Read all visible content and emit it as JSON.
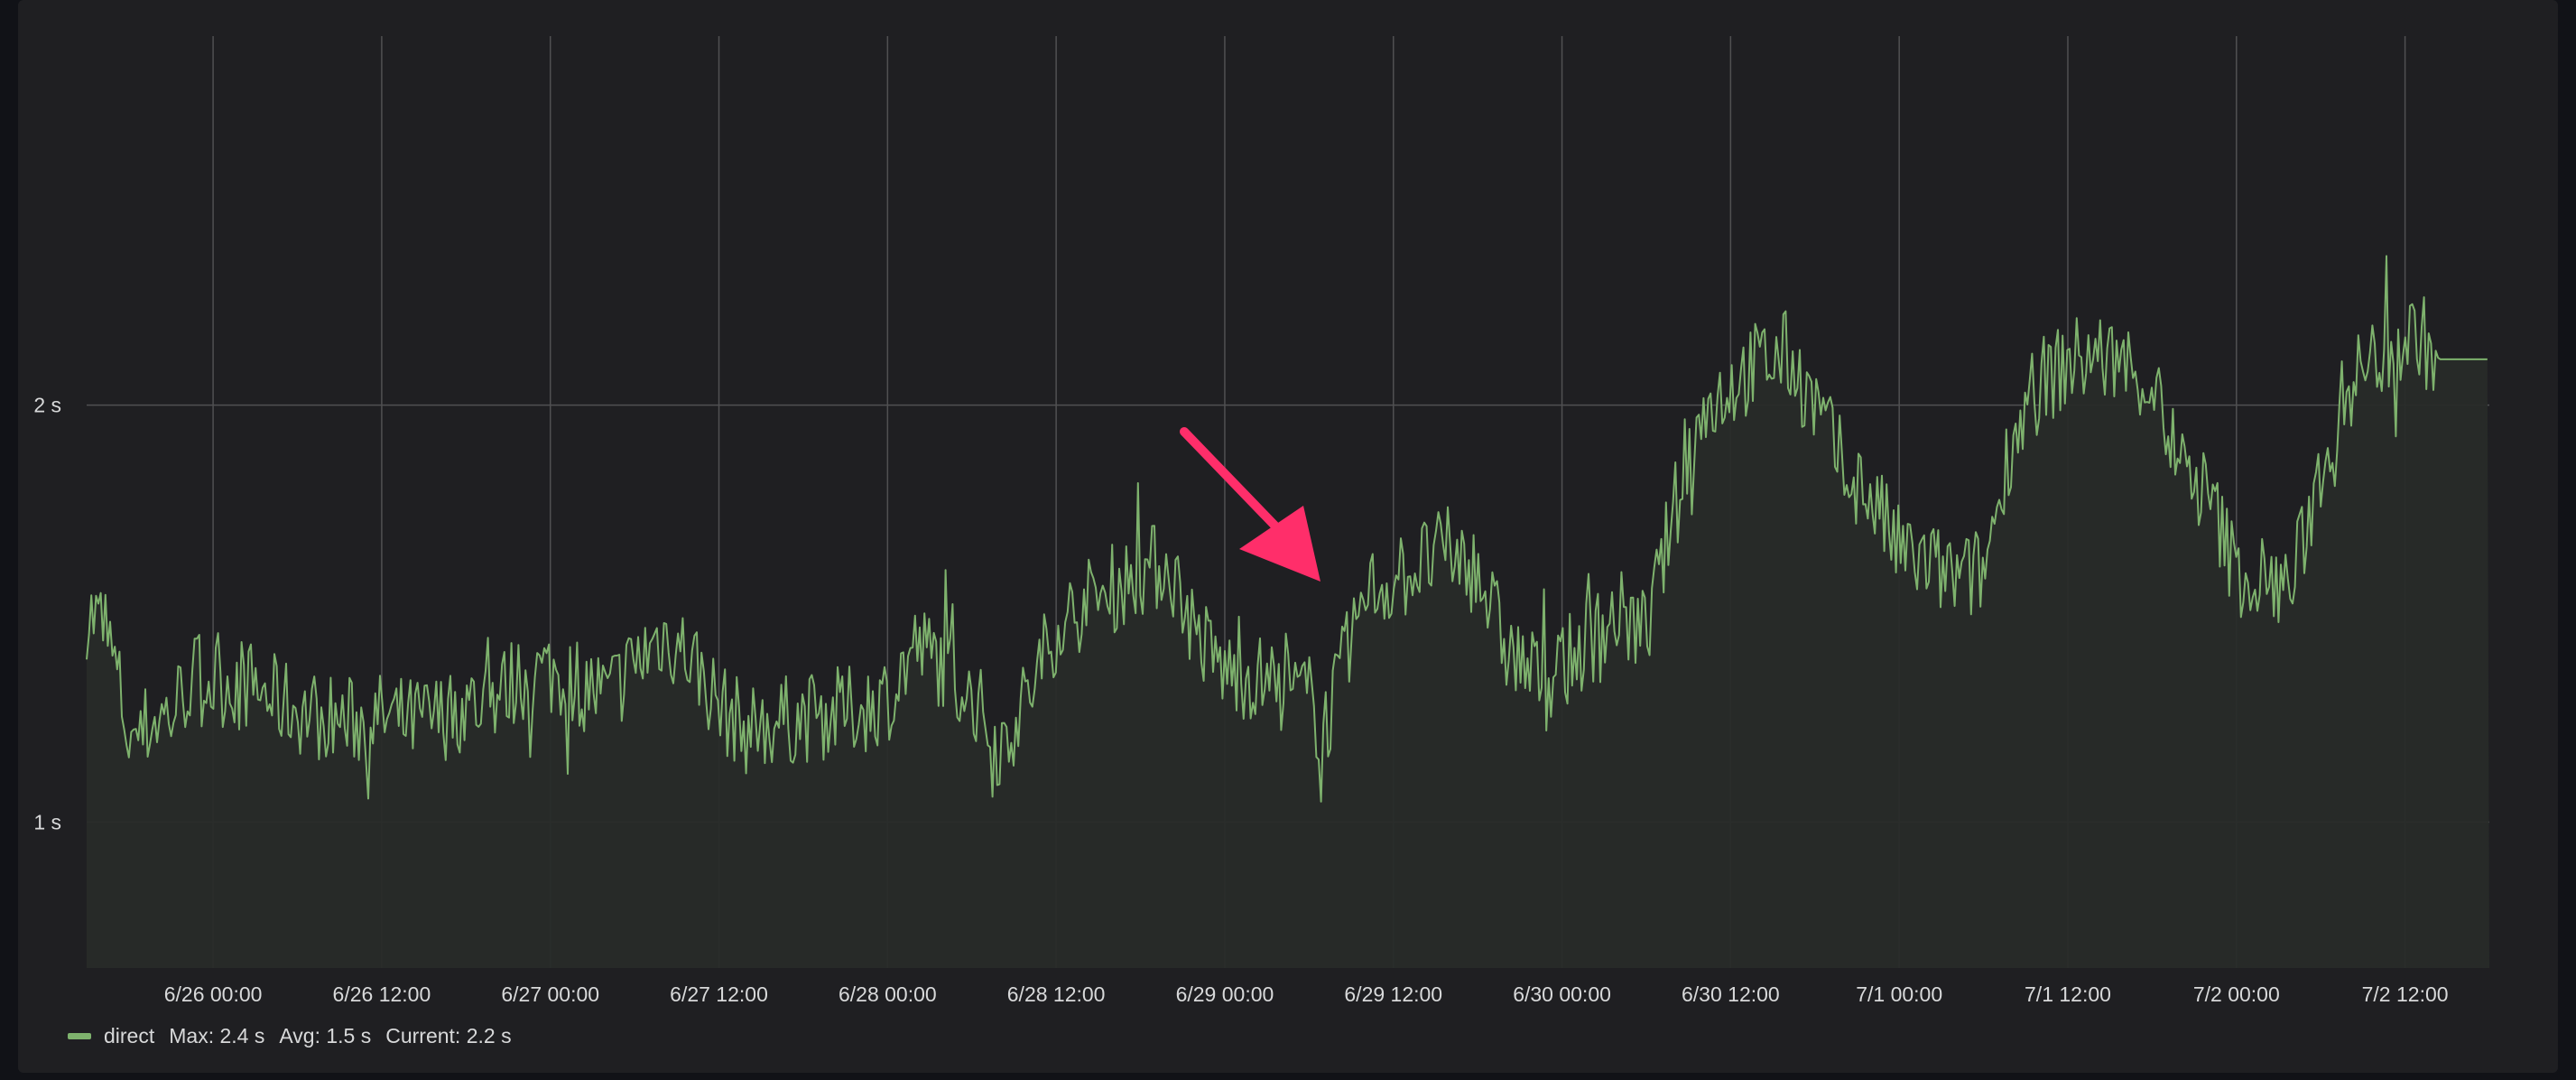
{
  "colors": {
    "background": "#1f1f22",
    "series": "#7eb26d",
    "fill": "#282b29",
    "grid": "#505052",
    "arrow": "#ff2e6a",
    "text": "#d8d9da"
  },
  "legend": {
    "series_name": "direct",
    "max_text": "Max: 2.4 s",
    "avg_text": "Avg: 1.5 s",
    "current_text": "Current: 2.2 s"
  },
  "annotation": {
    "type": "arrow",
    "icon": "arrow-pointer-icon",
    "points_to_x": "6/29 06:00"
  },
  "chart_data": {
    "type": "area",
    "title": "",
    "xlabel": "",
    "ylabel": "",
    "grid": true,
    "legend_position": "bottom-left",
    "x_range": [
      "2024-06-25T15:00",
      "2024-07-02T18:00"
    ],
    "ylim": [
      0.65,
      2.95
    ],
    "y_ticks": [
      {
        "value": 1,
        "label": "1 s"
      },
      {
        "value": 2,
        "label": "2 s"
      }
    ],
    "x_ticks": [
      {
        "t": "2024-06-26T00:00",
        "label": "6/26 00:00"
      },
      {
        "t": "2024-06-26T12:00",
        "label": "6/26 12:00"
      },
      {
        "t": "2024-06-27T00:00",
        "label": "6/27 00:00"
      },
      {
        "t": "2024-06-27T12:00",
        "label": "6/27 12:00"
      },
      {
        "t": "2024-06-28T00:00",
        "label": "6/28 00:00"
      },
      {
        "t": "2024-06-28T12:00",
        "label": "6/28 12:00"
      },
      {
        "t": "2024-06-29T00:00",
        "label": "6/29 00:00"
      },
      {
        "t": "2024-06-29T12:00",
        "label": "6/29 12:00"
      },
      {
        "t": "2024-06-30T00:00",
        "label": "6/30 00:00"
      },
      {
        "t": "2024-06-30T12:00",
        "label": "6/30 12:00"
      },
      {
        "t": "2024-07-01T00:00",
        "label": "7/1 00:00"
      },
      {
        "t": "2024-07-01T12:00",
        "label": "7/1 12:00"
      },
      {
        "t": "2024-07-02T00:00",
        "label": "7/2 00:00"
      },
      {
        "t": "2024-07-02T12:00",
        "label": "7/2 12:00"
      }
    ],
    "series": [
      {
        "name": "direct",
        "points": [
          [
            "2024-06-25T15:00",
            1.5
          ],
          [
            "2024-06-25T16:00",
            1.48
          ],
          [
            "2024-06-25T17:00",
            1.38
          ],
          [
            "2024-06-25T18:00",
            1.2
          ],
          [
            "2024-06-25T19:00",
            1.22
          ],
          [
            "2024-06-25T20:00",
            1.25
          ],
          [
            "2024-06-25T21:00",
            1.26
          ],
          [
            "2024-06-25T22:00",
            1.32
          ],
          [
            "2024-06-25T23:00",
            1.36
          ],
          [
            "2024-06-26T00:00",
            1.33
          ],
          [
            "2024-06-26T02:00",
            1.34
          ],
          [
            "2024-06-26T04:00",
            1.3
          ],
          [
            "2024-06-26T06:00",
            1.27
          ],
          [
            "2024-06-26T08:00",
            1.25
          ],
          [
            "2024-06-26T10:00",
            1.24
          ],
          [
            "2024-06-26T12:00",
            1.25
          ],
          [
            "2024-06-26T14:00",
            1.24
          ],
          [
            "2024-06-26T16:00",
            1.25
          ],
          [
            "2024-06-26T18:00",
            1.28
          ],
          [
            "2024-06-26T20:00",
            1.3
          ],
          [
            "2024-06-26T22:00",
            1.35
          ],
          [
            "2024-06-27T00:00",
            1.36
          ],
          [
            "2024-06-27T02:00",
            1.34
          ],
          [
            "2024-06-27T04:00",
            1.3
          ],
          [
            "2024-06-27T06:00",
            1.38
          ],
          [
            "2024-06-27T08:00",
            1.45
          ],
          [
            "2024-06-27T10:00",
            1.4
          ],
          [
            "2024-06-27T12:00",
            1.28
          ],
          [
            "2024-06-27T14:00",
            1.22
          ],
          [
            "2024-06-27T16:00",
            1.24
          ],
          [
            "2024-06-27T18:00",
            1.25
          ],
          [
            "2024-06-27T20:00",
            1.26
          ],
          [
            "2024-06-27T22:00",
            1.27
          ],
          [
            "2024-06-28T00:00",
            1.3
          ],
          [
            "2024-06-28T02:00",
            1.42
          ],
          [
            "2024-06-28T04:00",
            1.38
          ],
          [
            "2024-06-28T06:00",
            1.3
          ],
          [
            "2024-06-28T08:00",
            1.18
          ],
          [
            "2024-06-28T10:00",
            1.3
          ],
          [
            "2024-06-28T12:00",
            1.47
          ],
          [
            "2024-06-28T14:00",
            1.52
          ],
          [
            "2024-06-28T16:00",
            1.56
          ],
          [
            "2024-06-28T18:00",
            1.6
          ],
          [
            "2024-06-28T20:00",
            1.62
          ],
          [
            "2024-06-28T22:00",
            1.45
          ],
          [
            "2024-06-29T00:00",
            1.36
          ],
          [
            "2024-06-29T02:00",
            1.35
          ],
          [
            "2024-06-29T04:00",
            1.32
          ],
          [
            "2024-06-29T06:00",
            1.3
          ],
          [
            "2024-06-29T07:00",
            1.22
          ],
          [
            "2024-06-29T08:00",
            1.32
          ],
          [
            "2024-06-29T10:00",
            1.55
          ],
          [
            "2024-06-29T12:00",
            1.58
          ],
          [
            "2024-06-29T14:00",
            1.62
          ],
          [
            "2024-06-29T16:00",
            1.65
          ],
          [
            "2024-06-29T18:00",
            1.6
          ],
          [
            "2024-06-29T20:00",
            1.42
          ],
          [
            "2024-06-29T22:00",
            1.35
          ],
          [
            "2024-06-30T00:00",
            1.37
          ],
          [
            "2024-06-30T02:00",
            1.44
          ],
          [
            "2024-06-30T04:00",
            1.5
          ],
          [
            "2024-06-30T06:00",
            1.45
          ],
          [
            "2024-06-30T08:00",
            1.75
          ],
          [
            "2024-06-30T10:00",
            1.98
          ],
          [
            "2024-06-30T12:00",
            2.05
          ],
          [
            "2024-06-30T14:00",
            2.1
          ],
          [
            "2024-06-30T16:00",
            2.12
          ],
          [
            "2024-06-30T18:00",
            2.0
          ],
          [
            "2024-06-30T20:00",
            1.85
          ],
          [
            "2024-06-30T22:00",
            1.78
          ],
          [
            "2024-07-01T00:00",
            1.65
          ],
          [
            "2024-07-01T02:00",
            1.62
          ],
          [
            "2024-07-01T04:00",
            1.58
          ],
          [
            "2024-07-01T06:00",
            1.6
          ],
          [
            "2024-07-01T08:00",
            1.92
          ],
          [
            "2024-07-01T10:00",
            2.05
          ],
          [
            "2024-07-01T12:00",
            2.1
          ],
          [
            "2024-07-01T14:00",
            2.12
          ],
          [
            "2024-07-01T16:00",
            2.1
          ],
          [
            "2024-07-01T18:00",
            2.05
          ],
          [
            "2024-07-01T20:00",
            1.85
          ],
          [
            "2024-07-01T22:00",
            1.78
          ],
          [
            "2024-07-02T00:00",
            1.6
          ],
          [
            "2024-07-02T02:00",
            1.58
          ],
          [
            "2024-07-02T04:00",
            1.57
          ],
          [
            "2024-07-02T06:00",
            1.85
          ],
          [
            "2024-07-02T08:00",
            2.05
          ],
          [
            "2024-07-02T10:00",
            2.12
          ],
          [
            "2024-07-02T12:00",
            2.15
          ],
          [
            "2024-07-02T13:00",
            2.18
          ],
          [
            "2024-07-02T14:00",
            2.11
          ],
          [
            "2024-07-02T18:00",
            2.11
          ]
        ]
      }
    ]
  }
}
